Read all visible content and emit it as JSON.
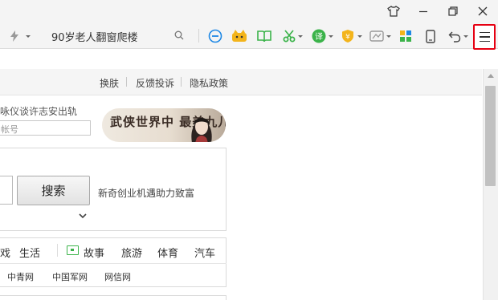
{
  "window": {
    "controls": [
      "skin-icon",
      "minimize-icon",
      "restore-icon",
      "close-icon"
    ]
  },
  "toolbar": {
    "search_query": "90岁老人翻窗爬楼",
    "extensions": [
      "flash-icon",
      "minus-circle-icon",
      "cartoon-cat-icon",
      "book-icon",
      "scissors-icon",
      "translate-icon",
      "coin-shield-icon",
      "game-controller-icon",
      "apps-grid-icon",
      "phone-icon",
      "undo-icon",
      "menu-icon"
    ]
  },
  "page": {
    "top_links": [
      "换肤",
      "反馈投诉",
      "隐私政策"
    ],
    "login_prompt": "咏仪谈许志安出轨",
    "account_placeholder": "帐号",
    "banner_text": "武侠世界中 最美九儿",
    "search_button": "搜索",
    "promo_text": "新奇创业机遇助力致富",
    "categories": [
      "戏",
      "生活",
      "故事",
      "旅游",
      "体育",
      "汽车"
    ],
    "sites": [
      "中青网",
      "中国军网",
      "网信网"
    ]
  },
  "colors": {
    "menu_highlight": "#e60012",
    "accent_green": "#3bb34a",
    "accent_blue": "#1e88e5"
  }
}
